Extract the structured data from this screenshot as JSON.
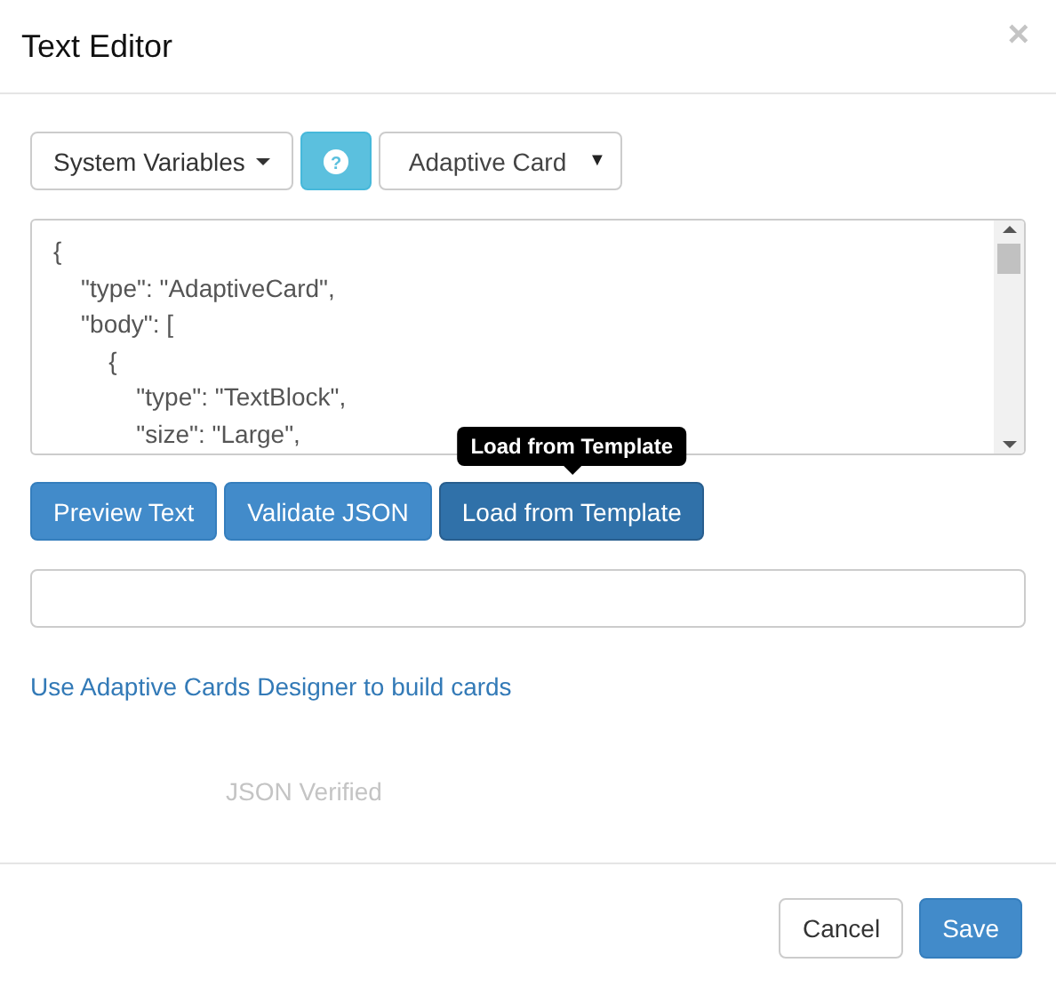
{
  "window": {
    "title": "Text Editor",
    "close": "×"
  },
  "toolbar": {
    "variables_button": "System Variables",
    "help_icon": "?",
    "format_select": "Adaptive Card",
    "select_caret": "▼"
  },
  "editor": {
    "lines": [
      "{",
      "    \"type\": \"AdaptiveCard\",",
      "    \"body\": [",
      "        {",
      "            \"type\": \"TextBlock\",",
      "            \"size\": \"Large\","
    ]
  },
  "actions": [
    {
      "label": "Preview Text",
      "active": false
    },
    {
      "label": "Validate JSON",
      "active": false
    },
    {
      "label": "Load from Template",
      "active": true
    }
  ],
  "tooltip": "Load from Template",
  "link": "Use Adaptive Cards Designer to build cards",
  "faded_notice": "JSON Verified",
  "footer": {
    "buttons": [
      {
        "label": "Cancel",
        "kind": "default"
      },
      {
        "label": "Save",
        "kind": "primary"
      }
    ]
  }
}
